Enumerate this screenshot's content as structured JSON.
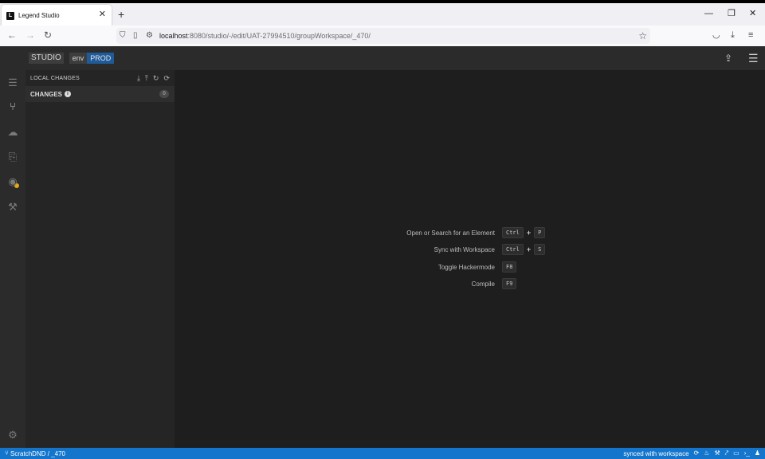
{
  "browser": {
    "tab_title": "Legend Studio",
    "tab_favicon": "L",
    "url_host": "localhost",
    "url_rest": ":8080/studio/-/edit/UAT-27994510/groupWorkspace/_470/"
  },
  "app": {
    "logo": {
      "studio": "STUDIO",
      "env": "env",
      "prod": "PROD"
    },
    "side_panel": {
      "title": "LOCAL CHANGES",
      "changes_label": "CHANGES",
      "changes_count": "0"
    },
    "shortcuts": [
      {
        "label": "Open or Search for an Element",
        "keys": [
          "Ctrl",
          "P"
        ]
      },
      {
        "label": "Sync with Workspace",
        "keys": [
          "Ctrl",
          "S"
        ]
      },
      {
        "label": "Toggle Hackermode",
        "keys": [
          "F8"
        ]
      },
      {
        "label": "Compile",
        "keys": [
          "F9"
        ]
      }
    ],
    "status_bar": {
      "branch": "ScratchDND",
      "separator": "/",
      "workspace": "_470",
      "sync_status": "synced with workspace"
    }
  },
  "colors": {
    "status_bar": "#1375cc",
    "prod_badge": "#1f5b99",
    "warning_dot": "#e6a817"
  },
  "icons": {
    "activity_bar": [
      "list-icon",
      "git-branch-icon",
      "cloud-upload-icon",
      "review-icon",
      "eye-icon",
      "wrench-icon",
      "settings-gear-icon"
    ]
  }
}
